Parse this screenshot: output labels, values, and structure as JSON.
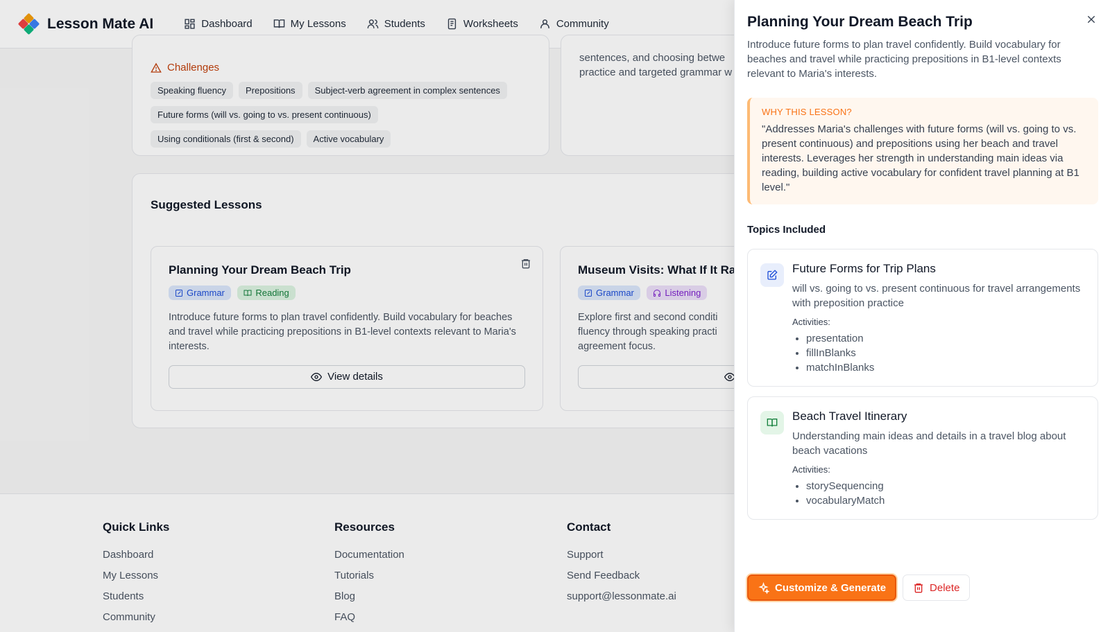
{
  "nav": {
    "brand": "Lesson Mate AI",
    "items": [
      {
        "label": "Dashboard",
        "icon": "dashboard-icon"
      },
      {
        "label": "My Lessons",
        "icon": "book-open-icon"
      },
      {
        "label": "Students",
        "icon": "users-icon"
      },
      {
        "label": "Worksheets",
        "icon": "worksheet-icon"
      },
      {
        "label": "Community",
        "icon": "community-icon"
      }
    ]
  },
  "challenges": {
    "title": "Challenges",
    "chips": [
      "Speaking fluency",
      "Prepositions",
      "Subject-verb agreement in complex sentences",
      "Future forms (will vs. going to vs. present continuous)",
      "Using conditionals (first & second)",
      "Active vocabulary"
    ]
  },
  "right_card_text": "sentences, and choosing betwe practice and targeted grammar w",
  "suggested": {
    "title": "Suggested Lessons",
    "lessons": [
      {
        "title": "Planning Your Dream Beach Trip",
        "badges": [
          "Grammar",
          "Reading"
        ],
        "desc": "Introduce future forms to plan travel confidently. Build vocabulary for beaches and travel while practicing prepositions in B1-level contexts relevant to Maria's interests.",
        "button": "View details"
      },
      {
        "title": "Museum Visits: What If It Ra",
        "badges": [
          "Grammar",
          "Listening"
        ],
        "desc": "Explore first and second conditi fluency through speaking practi agreement focus."
      }
    ]
  },
  "footer": {
    "quick_links": {
      "title": "Quick Links",
      "links": [
        "Dashboard",
        "My Lessons",
        "Students",
        "Community"
      ]
    },
    "resources": {
      "title": "Resources",
      "links": [
        "Documentation",
        "Tutorials",
        "Blog",
        "FAQ"
      ]
    },
    "contact": {
      "title": "Contact",
      "links": [
        "Support",
        "Send Feedback",
        "support@lessonmate.ai"
      ]
    }
  },
  "panel": {
    "title": "Planning Your Dream Beach Trip",
    "description": "Introduce future forms to plan travel confidently. Build vocabulary for beaches and travel while practicing prepositions in B1-level contexts relevant to Maria's interests.",
    "why_label": "WHY THIS LESSON?",
    "why_text": "\"Addresses Maria's challenges with future forms (will vs. going to vs. present continuous) and prepositions using her beach and travel interests. Leverages her strength in understanding main ideas via reading, building active vocabulary for confident travel planning at B1 level.\"",
    "topics_label": "Topics Included",
    "topics": [
      {
        "title": "Future Forms for Trip Plans",
        "desc": "will vs. going to vs. present continuous for travel arrangements with preposition practice",
        "activities_label": "Activities:",
        "activities": [
          "presentation",
          "fillInBlanks",
          "matchInBlanks"
        ],
        "icon": "grammar-edit-icon"
      },
      {
        "title": "Beach Travel Itinerary",
        "desc": "Understanding main ideas and details in a travel blog about beach vacations",
        "activities_label": "Activities:",
        "activities": [
          "storySequencing",
          "vocabularyMatch"
        ],
        "icon": "book-open-icon"
      }
    ],
    "primary_button": "Customize & Generate",
    "delete_button": "Delete"
  },
  "colors": {
    "accent": "#f97316",
    "danger": "#dc2626",
    "grammar": "#1d4ed8",
    "reading": "#15803d",
    "listening": "#7e22ce"
  }
}
